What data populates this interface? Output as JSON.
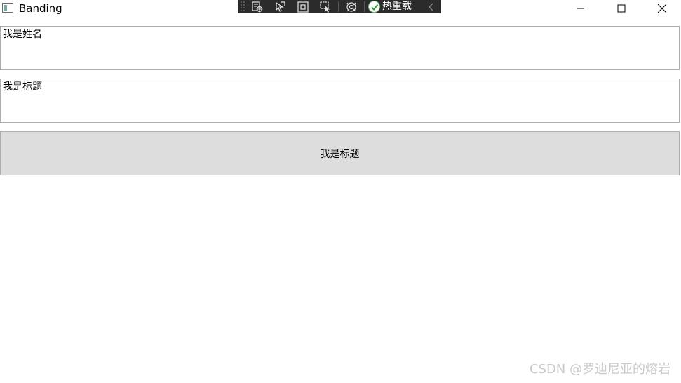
{
  "window": {
    "title": "Banding"
  },
  "debug_toolbar": {
    "icons": [
      "select-element-icon",
      "pointer-icon",
      "layout-adorners-icon",
      "track-focus-icon",
      "binding-failures-icon"
    ],
    "hot_reload_label": "热重载"
  },
  "window_controls": {
    "minimize": "minimize-icon",
    "maximize": "maximize-icon",
    "close": "close-icon"
  },
  "content": {
    "name_textbox_value": "我是姓名",
    "title_textbox_value": "我是标题",
    "button_label": "我是标题"
  },
  "watermark": "CSDN @罗迪尼亚的熔岩",
  "colors": {
    "toolbar_bg": "#2b2b2b",
    "button_bg": "#dddddd",
    "border": "#adadad",
    "hot_reload_check": "#2e9e2e"
  }
}
